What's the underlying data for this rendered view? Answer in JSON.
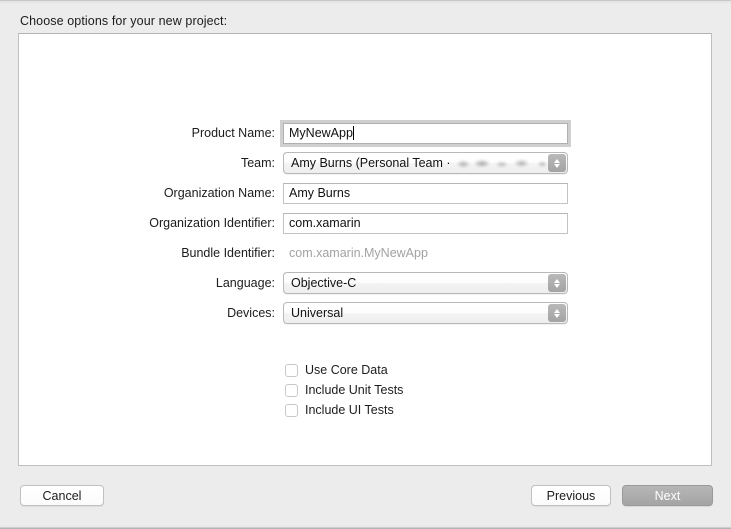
{
  "window": {
    "prompt": "Choose options for your new project:"
  },
  "form": {
    "fields": [
      {
        "label": "Product Name:",
        "type": "textfield",
        "value": "MyNewApp",
        "focused": true,
        "name": "product-name"
      },
      {
        "label": "Team:",
        "type": "popup",
        "value": "Amy Burns (Personal Team ·",
        "redacted": true,
        "name": "team"
      },
      {
        "label": "Organization Name:",
        "type": "textfield",
        "value": "Amy Burns",
        "focused": false,
        "name": "organization-name"
      },
      {
        "label": "Organization Identifier:",
        "type": "textfield",
        "value": "com.xamarin",
        "focused": false,
        "name": "organization-identifier"
      },
      {
        "label": "Bundle Identifier:",
        "type": "static",
        "value": "com.xamarin.MyNewApp",
        "name": "bundle-identifier"
      },
      {
        "label": "Language:",
        "type": "popup",
        "value": "Objective-C",
        "redacted": false,
        "name": "language"
      },
      {
        "label": "Devices:",
        "type": "popup",
        "value": "Universal",
        "redacted": false,
        "name": "devices"
      }
    ],
    "checkboxes": [
      {
        "label": "Use Core Data",
        "checked": false,
        "name": "use-core-data"
      },
      {
        "label": "Include Unit Tests",
        "checked": false,
        "name": "include-unit-tests"
      },
      {
        "label": "Include UI Tests",
        "checked": false,
        "name": "include-ui-tests"
      }
    ]
  },
  "footer": {
    "cancel_label": "Cancel",
    "previous_label": "Previous",
    "next_label": "Next"
  },
  "colors": {
    "window_background": "#ececec",
    "panel_background": "#ffffff",
    "panel_border": "#bfbfbf",
    "text_primary": "#1c1c1c",
    "text_disabled": "#a2a2a2",
    "default_button_background": "#ababab",
    "focus_ring": "#cfcfcf"
  }
}
